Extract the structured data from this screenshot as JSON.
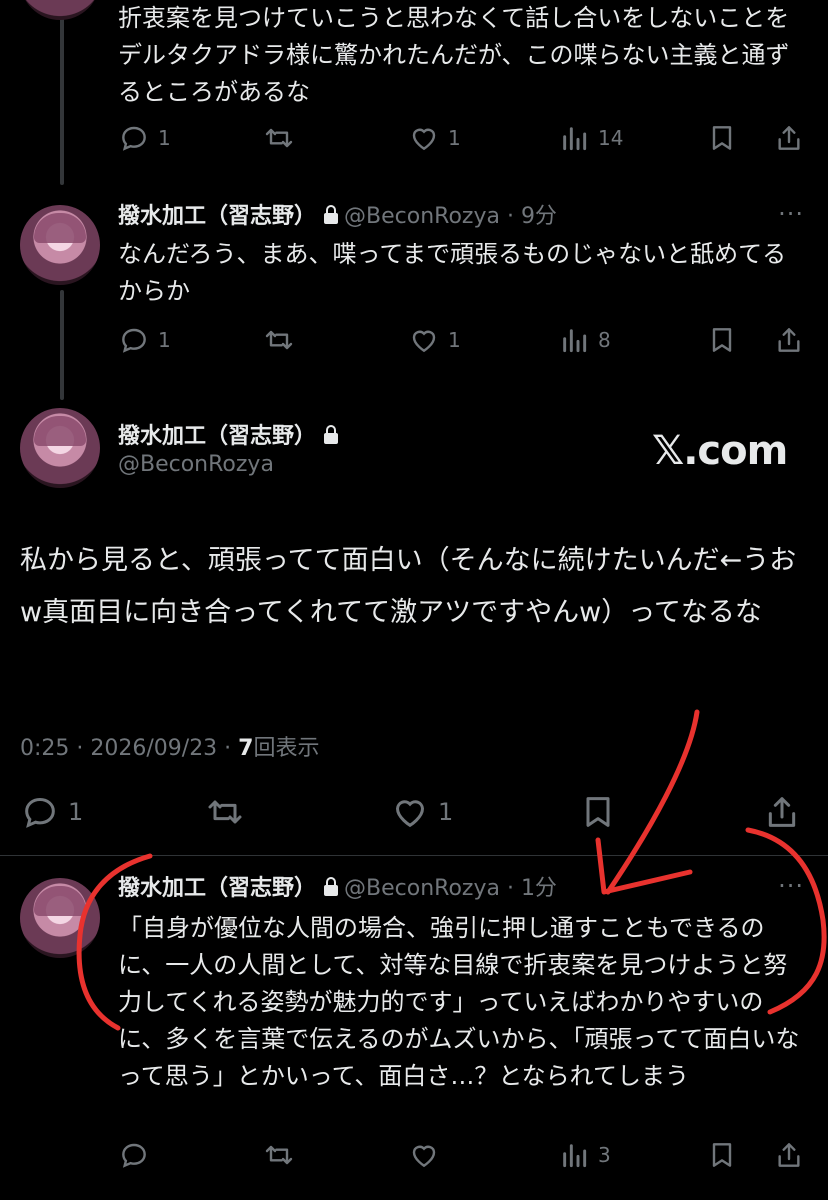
{
  "tweets": [
    {
      "text": "折衷案を見つけていこうと思わなくて話し合いをしないことをデルタクアドラ様に驚かれたんだが、この喋らない主義と通ずるところがあるな",
      "replies": "1",
      "retweets": "",
      "likes": "1",
      "views": "14"
    },
    {
      "name": "撥水加工（習志野）",
      "handle": "@BeconRozya",
      "time": "9分",
      "text": "なんだろう、まあ、喋ってまで頑張るものじゃないと舐めてるからか",
      "replies": "1",
      "retweets": "",
      "likes": "1",
      "views": "8"
    }
  ],
  "main": {
    "name": "撥水加工（習志野）",
    "handle": "@BeconRozya",
    "watermark": "𝕏.com",
    "text": "私から見ると、頑張ってて面白い（そんなに続けたいんだ←うおw真面目に向き合ってくれてて激アツですやんw）ってなるな",
    "time": "0:25 · 2026/09/23 · ",
    "views_count": "7",
    "views_label": "回表示",
    "replies": "1",
    "likes": "1"
  },
  "reply": {
    "name": "撥水加工（習志野）",
    "handle": "@BeconRozya",
    "time": "1分",
    "text": "「自身が優位な人間の場合、強引に押し通すこともできるのに、一人の人間として、対等な目線で折衷案を見つけようと努力してくれる姿勢が魅力的です」っていえばわかりやすいのに、多くを言葉で伝えるのがムズいから、「頑張ってて面白いなって思う」とかいって、面白さ…？となられてしまう",
    "views": "3"
  },
  "colors": {
    "background": "#000000",
    "text": "#e7e9ea",
    "muted": "#71767b",
    "annotation": "#e8322e"
  }
}
